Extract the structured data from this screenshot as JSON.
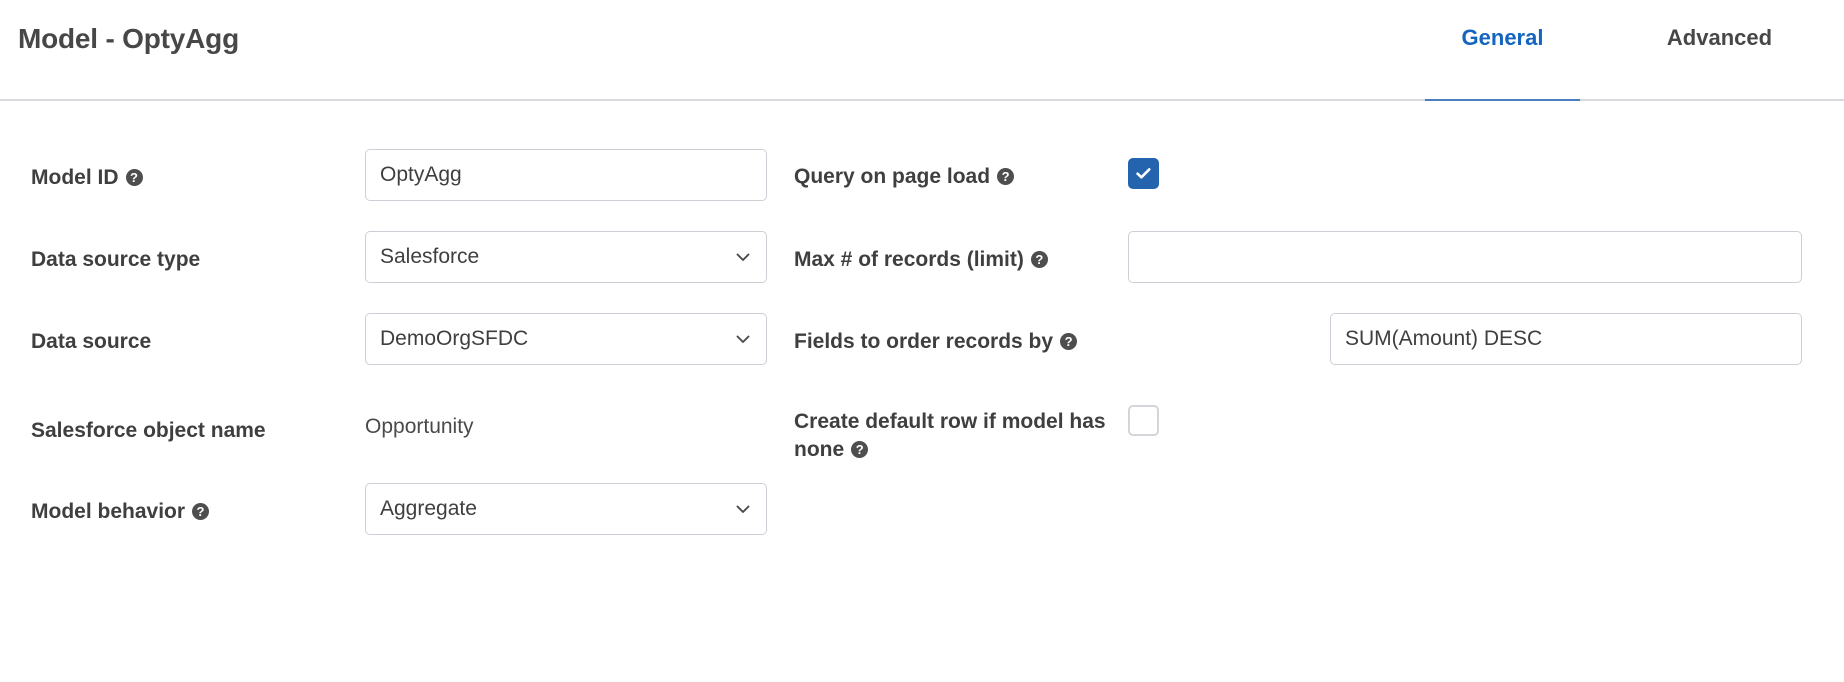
{
  "header": {
    "title": "Model - OptyAgg",
    "tabs": [
      {
        "label": "General",
        "active": true
      },
      {
        "label": "Advanced",
        "active": false
      }
    ]
  },
  "colors": {
    "tab_active_text": "#1565c0",
    "tab_active_underline": "#4a7fbe",
    "tab_inactive_text": "#474747",
    "checkbox_checked": "#2463ad",
    "field_border": "#ccd0d6",
    "label_text": "#3f3f3f"
  },
  "icons": {
    "help": "?",
    "chevron_down": "chevron-down-icon",
    "check": "check-icon"
  },
  "left_column": {
    "fields": [
      {
        "label": "Model ID",
        "has_help": true,
        "type": "text",
        "value": "OptyAgg",
        "placeholder": ""
      },
      {
        "label": "Data source type",
        "has_help": false,
        "type": "select",
        "value": "Salesforce"
      },
      {
        "label": "Data source",
        "has_help": false,
        "type": "select",
        "value": "DemoOrgSFDC"
      },
      {
        "label": "Salesforce object name",
        "has_help": false,
        "type": "static",
        "value": "Opportunity"
      },
      {
        "label": "Model behavior",
        "has_help": true,
        "type": "select",
        "value": "Aggregate"
      }
    ]
  },
  "right_column": {
    "fields": [
      {
        "label": "Query on page load",
        "has_help": true,
        "type": "checkbox",
        "checked": true
      },
      {
        "label": "Max # of records (limit)",
        "has_help": true,
        "type": "text",
        "value": "",
        "placeholder": ""
      },
      {
        "label": "Fields to order records by",
        "has_help": true,
        "type": "text",
        "value": "SUM(Amount) DESC",
        "placeholder": ""
      },
      {
        "label": "Create default row if model has none",
        "has_help": true,
        "type": "checkbox",
        "checked": false
      }
    ]
  }
}
